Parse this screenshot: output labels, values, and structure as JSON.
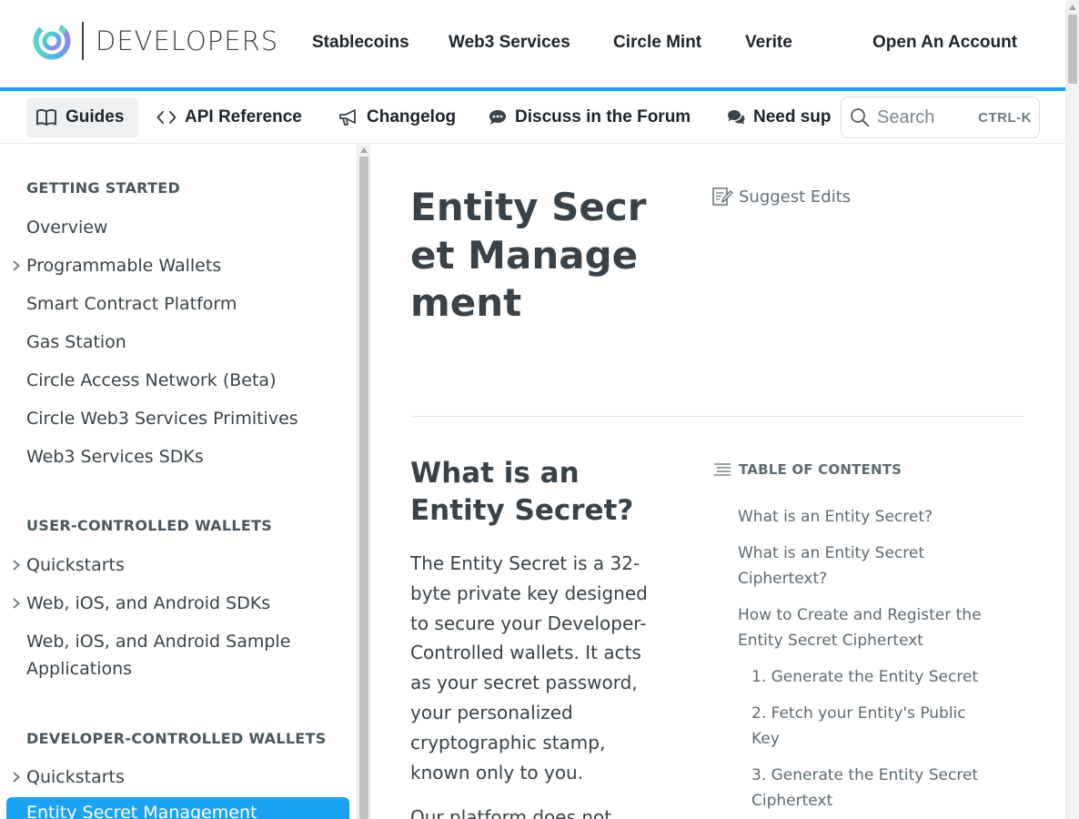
{
  "header": {
    "logo_text": "DEVELOPERS",
    "nav": [
      "Stablecoins",
      "Web3 Services",
      "Circle Mint",
      "Verite"
    ],
    "cta": "Open An Account"
  },
  "subnav": {
    "items": [
      {
        "label": "Guides",
        "icon": "book-icon",
        "active": true
      },
      {
        "label": "API Reference",
        "icon": "code-icon"
      },
      {
        "label": "Changelog",
        "icon": "megaphone-icon"
      },
      {
        "label": "Discuss in the Forum",
        "icon": "chat-bubble-icon"
      },
      {
        "label": "Need sup",
        "icon": "comments-icon"
      }
    ],
    "search_placeholder": "Search",
    "search_shortcut": "CTRL-K"
  },
  "sidebar": {
    "sections": [
      {
        "heading": "GETTING STARTED",
        "items": [
          "Overview",
          "Programmable Wallets",
          "Smart Contract Platform",
          "Gas Station",
          "Circle Access Network (Beta)",
          "Circle Web3 Services Primitives",
          "Web3 Services SDKs"
        ]
      },
      {
        "heading": "USER-CONTROLLED WALLETS",
        "items": [
          "Quickstarts",
          "Web, iOS, and Android SDKs",
          "Web, iOS, and Android Sample",
          "Applications"
        ]
      },
      {
        "heading": "DEVELOPER-CONTROLLED WALLETS",
        "items": [
          "Quickstarts"
        ]
      }
    ],
    "active_item": "Entity Secret Management"
  },
  "article": {
    "title": "Entity Secret Management",
    "suggest_edits": "Suggest Edits",
    "h2": "What is an Entity Secret?",
    "paragraph": "The Entity Secret is a 32-byte private key designed to secure your Developer-Controlled wallets. It acts as your secret password, your personalized cryptographic stamp, known only to you.",
    "paragraph2": "Our platform does not"
  },
  "toc": {
    "heading": "TABLE OF CONTENTS",
    "links": [
      "What is an Entity Secret?",
      "What is an Entity Secret Ciphertext?",
      "How to Create and Register the Entity Secret Ciphertext",
      "1. Generate the Entity Secret",
      "2. Fetch your Entity's Public Key",
      "3. Generate the Entity Secret Ciphertext"
    ]
  },
  "colors": {
    "accent": "#1ba3f3",
    "text": "#384248",
    "muted": "#5d6a72"
  }
}
